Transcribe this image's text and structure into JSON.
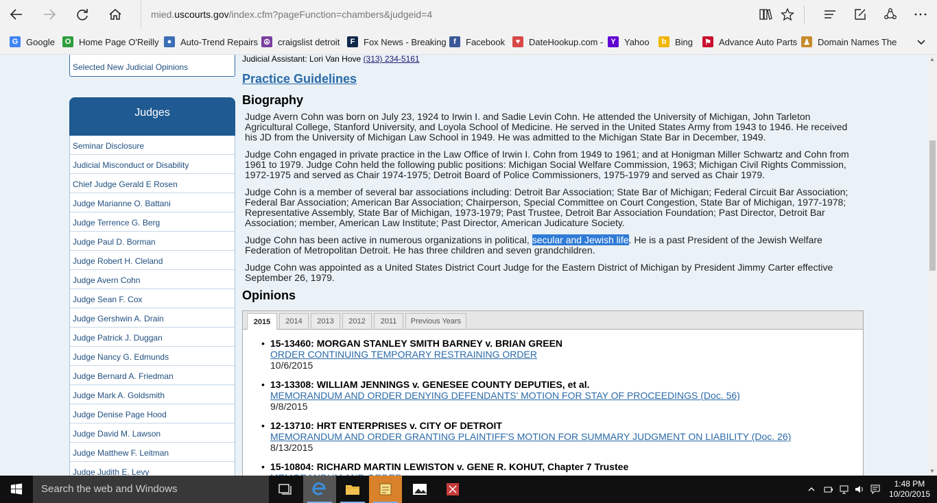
{
  "browser": {
    "url_prefix": "mied.",
    "url_domain": "uscourts.gov",
    "url_suffix": "/index.cfm?pageFunction=chambers&judgeid=4"
  },
  "favorites": [
    {
      "label": "Google",
      "icon": "google-icon",
      "color": "#4285f4",
      "glyph": "G"
    },
    {
      "label": "Home Page  O'Reilly",
      "icon": "oreilly-icon",
      "color": "#2e9e3e",
      "glyph": "O"
    },
    {
      "label": "Auto-Trend Repairs",
      "icon": "globe-icon",
      "color": "#3b6fb6",
      "glyph": "●"
    },
    {
      "label": "craigslist detroit",
      "icon": "craigslist-icon",
      "color": "#7a3fa0",
      "glyph": "☮"
    },
    {
      "label": "Fox News - Breaking",
      "icon": "foxnews-icon",
      "color": "#10284a",
      "glyph": "F"
    },
    {
      "label": "Facebook",
      "icon": "facebook-icon",
      "color": "#3b5998",
      "glyph": "f"
    },
    {
      "label": "DateHookup.com -",
      "icon": "heart-icon",
      "color": "#d94848",
      "glyph": "♥"
    },
    {
      "label": "Yahoo",
      "icon": "yahoo-icon",
      "color": "#5f01d1",
      "glyph": "Y"
    },
    {
      "label": "Bing",
      "icon": "bing-icon",
      "color": "#f2b600",
      "glyph": "b"
    },
    {
      "label": "Advance Auto Parts",
      "icon": "checkered-flag-icon",
      "color": "#c8102e",
      "glyph": "⚑"
    },
    {
      "label": "Domain Names  The",
      "icon": "domain-icon",
      "color": "#c78b2c",
      "glyph": "♟"
    }
  ],
  "sidebar": {
    "selected_opinions": "Selected New Judicial Opinions",
    "judges_header": "Judges",
    "items": [
      "Seminar Disclosure",
      "Judicial Misconduct or Disability",
      "Chief Judge Gerald E Rosen",
      "Judge Marianne O. Battani",
      "Judge Terrence G. Berg",
      "Judge Paul D. Borman",
      "Judge Robert H. Cleland",
      "Judge Avern Cohn",
      "Judge Sean F. Cox",
      "Judge Gershwin A. Drain",
      "Judge Patrick J. Duggan",
      "Judge Nancy G. Edmunds",
      "Judge Bernard A. Friedman",
      "Judge Mark A. Goldsmith",
      "Judge Denise Page Hood",
      "Judge David M. Lawson",
      "Judge Matthew F. Leitman",
      "Judge Judith E. Levy"
    ]
  },
  "main": {
    "assistant_label": "Judicial Assistant: Lori Van Hove ",
    "assistant_phone": "(313) 234-5161",
    "practice_guidelines": "Practice Guidelines",
    "biography_heading": "Biography",
    "bio_p1": "Judge Avern Cohn was born on July 23, 1924 to Irwin I. and Sadie Levin Cohn. He attended the University of Michigan, John Tarleton Agricultural College, Stanford University, and Loyola School of Medicine. He served in the United States Army from 1943 to 1946. He received his JD from the University of Michigan Law School in 1949. He was admitted to the Michigan State Bar in December, 1949.",
    "bio_p2": "Judge Cohn engaged in private practice in the Law Office of Irwin I. Cohn from 1949 to 1961; and at Honigman Miller Schwartz and Cohn from 1961 to 1979. Judge Cohn held the following public positions: Michigan Social Welfare Commission, 1963; Michigan Civil Rights Commission, 1972-1975 and served as Chair 1974-1975; Detroit Board of Police Commissioners, 1975-1979 and served as Chair 1979.",
    "bio_p3": "Judge Cohn is a member of several bar associations including: Detroit Bar Association; State Bar of Michigan; Federal Circuit Bar Association; Federal Bar Association; American Bar Association; Chairperson, Special Committee on Court Congestion, State Bar of Michigan, 1977-1978; Representative Assembly, State Bar of Michigan, 1973-1979; Past Trustee, Detroit Bar Association Foundation; Past Director, Detroit Bar Association; member, American Law Institute; Past Director, American Judicature Society.",
    "bio_p4_a": "Judge Cohn has been active in numerous organizations in political, ",
    "bio_p4_hl": "secular and Jewish life",
    "bio_p4_b": ". He is a past President of the Jewish Welfare Federation of Metropolitan Detroit. He has three children and seven grandchildren.",
    "bio_p5": "Judge Cohn was appointed as a United States District Court Judge for the Eastern District of Michigan by President Jimmy Carter effective September 26, 1979.",
    "opinions_heading": "Opinions",
    "tabs": [
      "2015",
      "2014",
      "2013",
      "2012",
      "2011",
      "Previous Years"
    ],
    "active_tab": "2015",
    "cases": [
      {
        "title": "15-13460: MORGAN STANLEY SMITH BARNEY v. BRIAN GREEN",
        "link": "ORDER CONTINUING TEMPORARY RESTRAINING ORDER",
        "date": "10/6/2015"
      },
      {
        "title": "13-13308: WILLIAM JENNINGS v. GENESEE COUNTY DEPUTIES, et al.",
        "link": "MEMORANDUM AND ORDER DENYING DEFENDANTS' MOTION FOR STAY OF PROCEEDINGS (Doc. 56)",
        "date": "9/8/2015"
      },
      {
        "title": "12-13710: HRT ENTERPRISES v. CITY OF DETROIT",
        "link": "MEMORANDUM AND ORDER GRANTING PLAINTIFF'S MOTION FOR SUMMARY JUDGMENT ON LIABILITY (Doc. 26)",
        "date": "8/13/2015"
      },
      {
        "title": "15-10804: RICHARD MARTIN LEWISTON v. GENE R. KOHUT, Chapter 7 Trustee",
        "link": "MEMORANDUM AND ORDER",
        "date": ""
      }
    ]
  },
  "taskbar": {
    "search_placeholder": "Search the web and Windows",
    "time": "1:48 PM",
    "date": "10/20/2015"
  }
}
